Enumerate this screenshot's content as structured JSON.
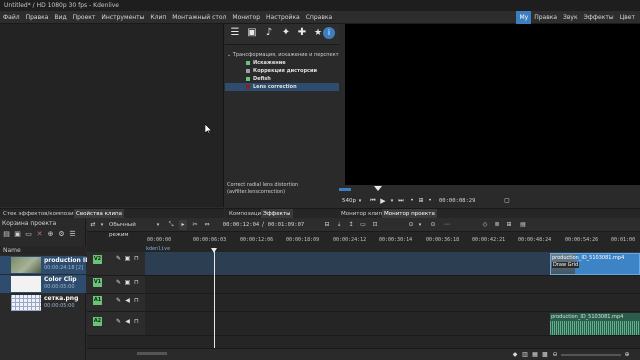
{
  "window": {
    "title": "Untitled* / HD 1080p 30 fps - Kdenlive"
  },
  "menu": {
    "items": [
      "Файл",
      "Правка",
      "Вид",
      "Проект",
      "Инструменты",
      "Клип",
      "Монтажный стол",
      "Монитор",
      "Настройка",
      "Справка"
    ]
  },
  "workspaces": {
    "items": [
      "Мy",
      "Правка",
      "Звук",
      "Эффекты",
      "Цвет"
    ],
    "active_index": 0
  },
  "effects_panel": {
    "group": "Трансформация, искажение и перспекти",
    "items": [
      {
        "label": "Искажение",
        "icon": "effect-box-icon",
        "selected": false
      },
      {
        "label": "Коррекция дисторсии",
        "icon": "effect-box-icon",
        "selected": false
      },
      {
        "label": "Defish",
        "icon": "effect-box-icon",
        "selected": false
      },
      {
        "label": "Lens correction",
        "icon": "effect-box-icon",
        "selected": true
      }
    ],
    "description_line1": "Correct radial lens distortion",
    "description_line2": "(avfilter.lenscorrection)"
  },
  "project_monitor": {
    "zoom": "540p",
    "timecode": "00:00:08:29",
    "progress_fraction": 0.04
  },
  "dock_tabs_left": [
    "Стек эффектов/композиций",
    "Свойства клипа"
  ],
  "dock_tabs_right": [
    "Композиции",
    "Эффекты",
    "Монитор клипа",
    "Монитор проекта"
  ],
  "bin": {
    "title": "Корзина проекта",
    "column_header": "Name",
    "clips": [
      {
        "name": "production ID",
        "info": "00:00:24:18 [2]",
        "selected": true
      },
      {
        "name": "Color Clip",
        "info": "00:00:05:00",
        "selected": true
      },
      {
        "name": "сетка.png",
        "info": "00:00:05:00",
        "selected": false
      }
    ]
  },
  "timeline": {
    "mode": "Обычный режим",
    "position": "00:00:12:04",
    "duration": "00:01:09:07",
    "ruler_ticks": [
      "00:00:00",
      "00:00:06:03",
      "00:00:12:06",
      "00:00:18:09",
      "00:00:24:12",
      "00:00:30:14",
      "00:00:36:18",
      "00:00:42:21",
      "00:00:48:24",
      "00:00:54:26",
      "00:01:00"
    ],
    "marker": "kdenlive",
    "tracks": [
      "V2",
      "V1",
      "A1",
      "A2"
    ],
    "video_clip": {
      "title": "production_ID_5103081.mp4",
      "effect": "Draw Grid"
    },
    "audio_clip": {
      "title": "production_ID_5103081.mp4"
    }
  }
}
